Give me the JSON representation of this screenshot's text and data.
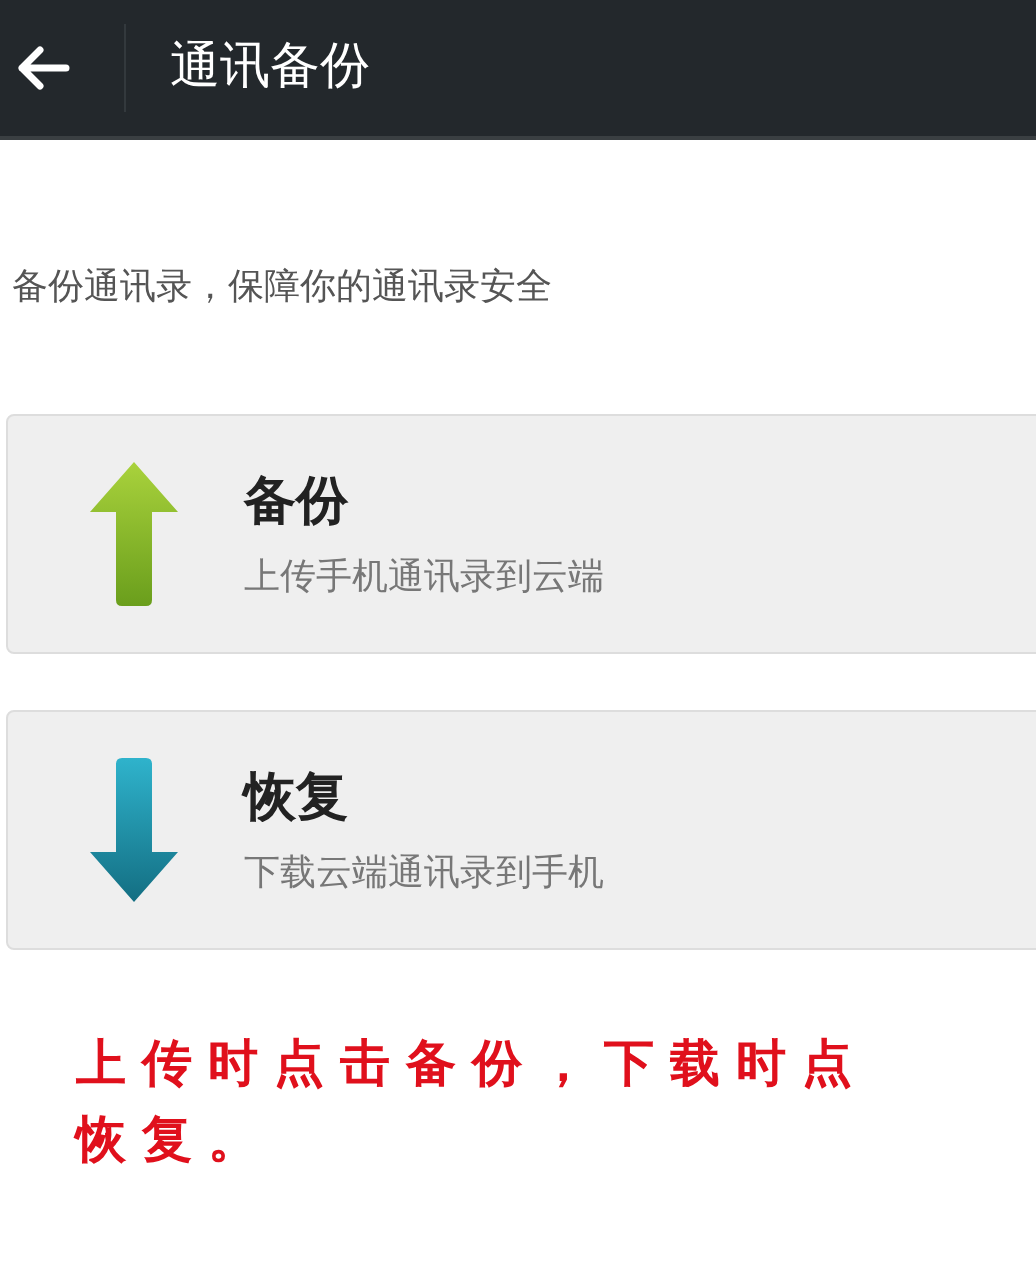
{
  "header": {
    "title": "通讯备份"
  },
  "description": "备份通讯录，保障你的通讯录安全",
  "options": [
    {
      "kind": "upload",
      "title": "备份",
      "subtitle": "上传手机通讯录到云端"
    },
    {
      "kind": "download",
      "title": "恢复",
      "subtitle": "下载云端通讯录到手机"
    }
  ],
  "annotation": [
    "上传时点击备份，下载时点",
    "恢复。"
  ]
}
